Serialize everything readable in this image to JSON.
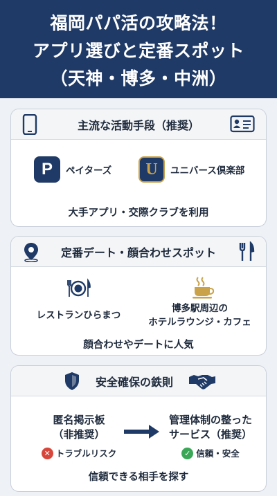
{
  "header": {
    "line1": "福岡パパ活の攻略法！",
    "line2": "アプリ選びと定番スポット",
    "line3": "（天神・博多・中洲）"
  },
  "sections": {
    "apps": {
      "title": "主流な活動手段（推奨）",
      "app1": {
        "logo_letter": "P",
        "name": "ペイターズ"
      },
      "app2": {
        "logo_letter": "U",
        "name": "ユニバース倶楽部"
      },
      "caption": "大手アプリ・交際クラブを利用"
    },
    "spots": {
      "title": "定番デート・顔合わせスポット",
      "spot1": "レストランひらまつ",
      "spot2_line1": "博多駅周辺の",
      "spot2_line2": "ホテルラウンジ・カフェ",
      "caption": "顔合わせやデートに人気"
    },
    "safety": {
      "title": "安全確保の鉄則",
      "bad_line1": "匿名掲示板",
      "bad_line2": "（非推奨）",
      "bad_tag": "トラブルリスク",
      "good_line1": "管理体制の整った",
      "good_line2": "サービス（推奨）",
      "good_tag": "信頼・安全",
      "caption": "信頼できる相手を探す"
    }
  },
  "colors": {
    "navy": "#1f3a66",
    "gold": "#c9a24a",
    "red": "#d8453a",
    "green": "#3aa757"
  },
  "icons": [
    "smartphone-icon",
    "id-card-icon",
    "location-pin-icon",
    "fork-knife-icon",
    "dining-plate-icon",
    "coffee-cup-icon",
    "shield-icon",
    "handshake-icon",
    "arrow-right-icon",
    "x-circle-icon",
    "check-circle-icon"
  ]
}
